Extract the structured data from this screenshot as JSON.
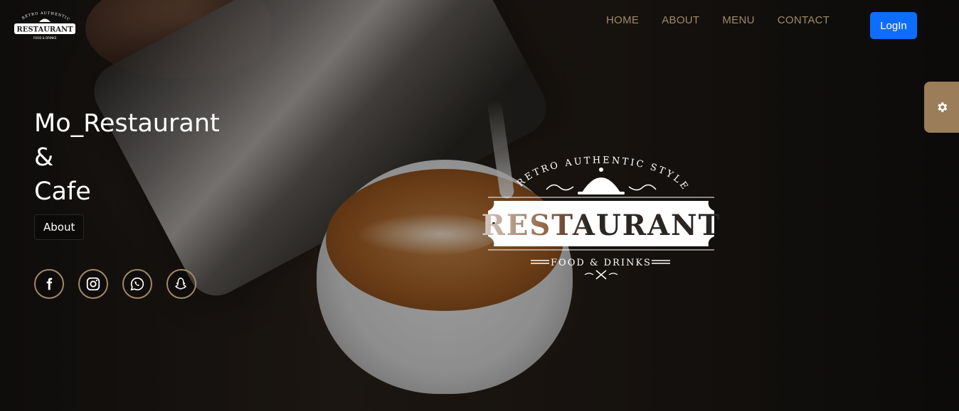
{
  "logo": {
    "arc_text": "RETRO AUTHENTIC STYLE",
    "name": "RESTAURANT",
    "tagline": "FOOD & DRINKS"
  },
  "nav": {
    "items": [
      "HOME",
      "ABOUT",
      "MENU",
      "CONTACT"
    ],
    "login_label": "LogIn"
  },
  "hero": {
    "title_lines": [
      "Mo_Restaurant",
      "&",
      "Cafe"
    ],
    "about_label": "About"
  },
  "socials": [
    {
      "icon": "facebook-icon"
    },
    {
      "icon": "instagram-icon"
    },
    {
      "icon": "whatsapp-icon"
    },
    {
      "icon": "snapchat-icon"
    }
  ],
  "colors": {
    "accent_gold": "#a08a64",
    "settings_tab": "#9b7d5a",
    "login_blue": "#0d6efd"
  },
  "icons": {
    "settings": "gear-icon"
  }
}
